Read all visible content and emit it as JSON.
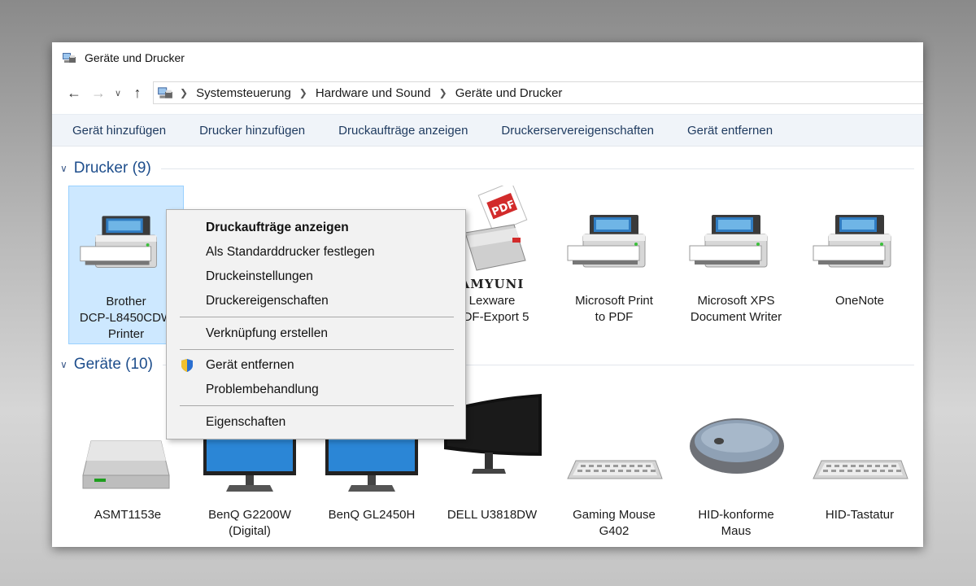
{
  "window": {
    "title": "Geräte und Drucker"
  },
  "address": {
    "crumbs": [
      "Systemsteuerung",
      "Hardware und Sound",
      "Geräte und Drucker"
    ]
  },
  "commands": [
    "Gerät hinzufügen",
    "Drucker hinzufügen",
    "Druckaufträge anzeigen",
    "Druckerservereigenschaften",
    "Gerät entfernen"
  ],
  "groups": {
    "printers": {
      "header": "Drucker (9)",
      "items": [
        {
          "lines": [
            "Brother",
            "DCP-L8450CDW",
            "Printer"
          ],
          "icon": "printer-icon"
        },
        {
          "lines": [
            "Lexware",
            "PDF-Export 5"
          ],
          "icon": "pdf-printer-icon",
          "brand": "AMYUNI",
          "badge": "PDF"
        },
        {
          "lines": [
            "Microsoft Print",
            "to PDF"
          ],
          "icon": "printer-icon"
        },
        {
          "lines": [
            "Microsoft XPS",
            "Document Writer"
          ],
          "icon": "printer-icon"
        },
        {
          "lines": [
            "OneNote"
          ],
          "icon": "printer-icon"
        }
      ]
    },
    "devices": {
      "header": "Geräte (10)",
      "items": [
        {
          "lines": [
            "ASMT1153e"
          ],
          "icon": "drive-icon"
        },
        {
          "lines": [
            "BenQ G2200W",
            "(Digital)"
          ],
          "icon": "monitor-icon"
        },
        {
          "lines": [
            "BenQ GL2450H"
          ],
          "icon": "monitor-icon"
        },
        {
          "lines": [
            "DELL U3818DW"
          ],
          "icon": "curved-monitor-icon"
        },
        {
          "lines": [
            "Gaming Mouse",
            "G402"
          ],
          "icon": "keyboard-icon"
        },
        {
          "lines": [
            "HID-konforme",
            "Maus"
          ],
          "icon": "mouse-icon"
        },
        {
          "lines": [
            "HID-Tastatur"
          ],
          "icon": "keyboard-icon"
        }
      ]
    }
  },
  "context_menu": {
    "items": [
      {
        "label": "Druckaufträge anzeigen",
        "bold": true
      },
      {
        "label": "Als Standarddrucker festlegen"
      },
      {
        "label": "Druckeinstellungen"
      },
      {
        "label": "Druckereigenschaften"
      },
      {
        "label": "Verknüpfung erstellen"
      },
      {
        "label": "Gerät entfernen",
        "icon": "uac-shield-icon"
      },
      {
        "label": "Problembehandlung"
      },
      {
        "label": "Eigenschaften"
      }
    ]
  },
  "colors": {
    "selection": "#cde8ff",
    "link": "#1e4e8c",
    "cmdbar": "#f0f4f9",
    "led": "#3cc03c"
  }
}
